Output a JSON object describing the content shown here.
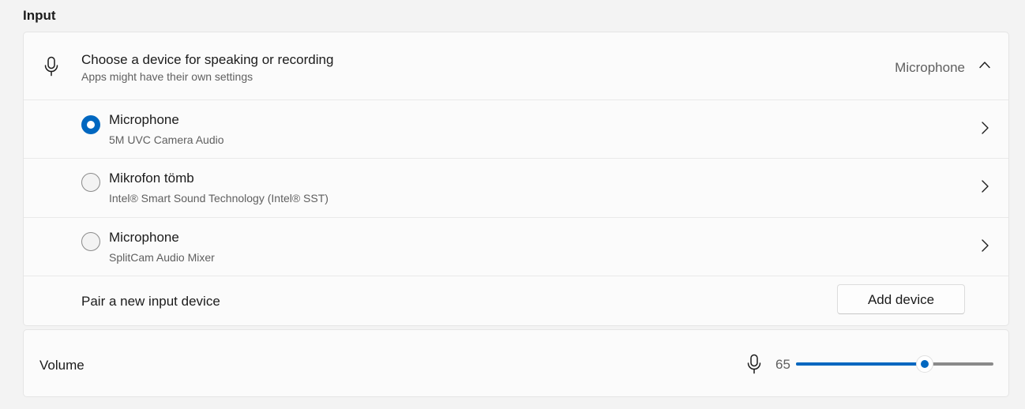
{
  "section": {
    "title": "Input"
  },
  "input_card": {
    "header": {
      "title": "Choose a device for speaking or recording",
      "subtitle": "Apps might have their own settings",
      "selected": "Microphone",
      "icon": "microphone-icon",
      "expand_icon": "chevron-up-icon"
    },
    "devices": [
      {
        "name": "Microphone",
        "description": "5M UVC Camera Audio",
        "selected": true
      },
      {
        "name": "Mikrofon tömb",
        "description": "Intel® Smart Sound Technology (Intel® SST)",
        "selected": false
      },
      {
        "name": "Microphone",
        "description": "SplitCam Audio Mixer",
        "selected": false
      }
    ],
    "pair": {
      "label": "Pair a new input device",
      "button_label": "Add device"
    }
  },
  "volume": {
    "label": "Volume",
    "value": "65",
    "level_percent": 65,
    "icon": "microphone-icon"
  },
  "colors": {
    "accent": "#0067c0",
    "background": "#f3f3f3",
    "card": "#fbfbfb",
    "secondary_text": "#5f5f5f"
  }
}
